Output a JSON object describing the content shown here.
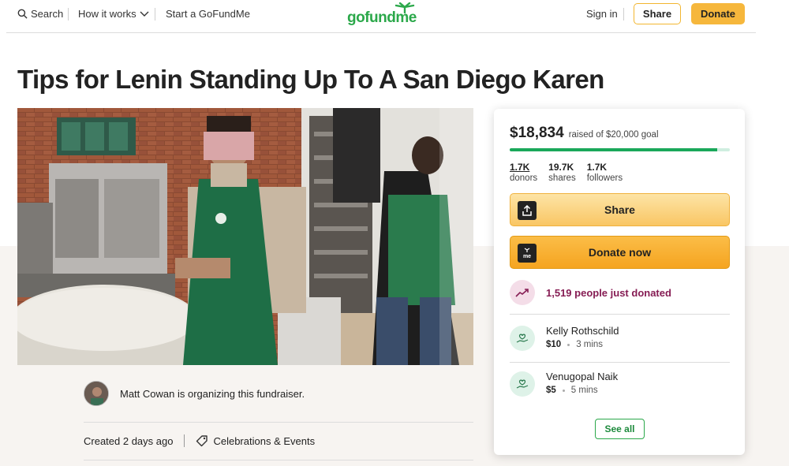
{
  "header": {
    "search_label": "Search",
    "how_it_works_label": "How it works",
    "start_label": "Start a GoFundMe",
    "logo_text": "gofundme",
    "signin_label": "Sign in",
    "share_label": "Share",
    "donate_label": "Donate"
  },
  "campaign": {
    "title": "Tips for Lenin Standing Up To A San Diego Karen",
    "organizer_text": "Matt Cowan is organizing this fundraiser.",
    "created_text": "Created 2 days ago",
    "category": "Celebrations & Events"
  },
  "card": {
    "raised_amount": "$18,834",
    "goal_text": "raised of $20,000 goal",
    "progress_fraction": 0.9417,
    "stats": [
      {
        "value": "1.7K",
        "label": "donors"
      },
      {
        "value": "19.7K",
        "label": "shares"
      },
      {
        "value": "1.7K",
        "label": "followers"
      }
    ],
    "share_button_label": "Share",
    "donate_button_label": "Donate now",
    "donate_icon_text": "me",
    "recent_text": "1,519 people just donated",
    "donations": [
      {
        "name": "Kelly Rothschild",
        "amount": "$10",
        "time": "3 mins"
      },
      {
        "name": "Venugopal Naik",
        "amount": "$5",
        "time": "5 mins"
      }
    ],
    "see_all_label": "See all"
  },
  "colors": {
    "brand_green": "#2ba84a",
    "donate_orange": "#f5a420",
    "trend_purple": "#861d54"
  },
  "icons": [
    "search-icon",
    "chevron-down-icon",
    "upload-share-icon",
    "gofundme-me-icon",
    "trending-up-icon",
    "donor-heart-hand-icon",
    "tag-icon"
  ]
}
